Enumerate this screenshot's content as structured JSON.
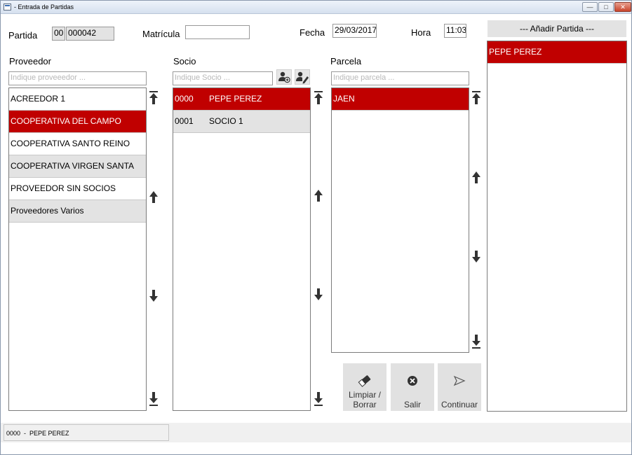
{
  "window": {
    "title": "- Entrada de Partidas",
    "minimize": "—",
    "maximize": "□",
    "close": "✕"
  },
  "header": {
    "partida_label": "Partida",
    "partida_series": "00",
    "partida_number": "000042",
    "matricula_label": "Matrícula",
    "matricula_value": "",
    "fecha_label": "Fecha",
    "fecha_value": "29/03/2017",
    "hora_label": "Hora",
    "hora_value": "11:03"
  },
  "proveedor": {
    "title": "Proveedor",
    "search_placeholder": "Indique proveeedor ...",
    "items": [
      {
        "label": "ACREEDOR 1"
      },
      {
        "label": "COOPERATIVA DEL CAMPO"
      },
      {
        "label": "COOPERATIVA SANTO REINO"
      },
      {
        "label": "COOPERATIVA VIRGEN SANTA"
      },
      {
        "label": "PROVEEDOR SIN SOCIOS"
      },
      {
        "label": "Proveedores Varios"
      }
    ]
  },
  "socio": {
    "title": "Socio",
    "search_placeholder": "Indique Socio ...",
    "items": [
      {
        "code": "0000",
        "name": "PEPE PEREZ"
      },
      {
        "code": "0001",
        "name": "SOCIO 1"
      }
    ]
  },
  "parcela": {
    "title": "Parcela",
    "search_placeholder": "Indique parcela ...",
    "items": [
      {
        "label": "JAEN"
      }
    ]
  },
  "actions": {
    "limpiar_line1": "Limpiar /",
    "limpiar_line2": "Borrar",
    "salir": "Salir",
    "continuar": "Continuar"
  },
  "add_panel": {
    "header": "--- Añadir Partida ---",
    "items": [
      {
        "label": "PEPE PEREZ"
      }
    ]
  },
  "status": {
    "text": "0000  -  PEPE PEREZ"
  },
  "colors": {
    "selection": "#c00000",
    "alt_row": "#e3e3e3"
  }
}
